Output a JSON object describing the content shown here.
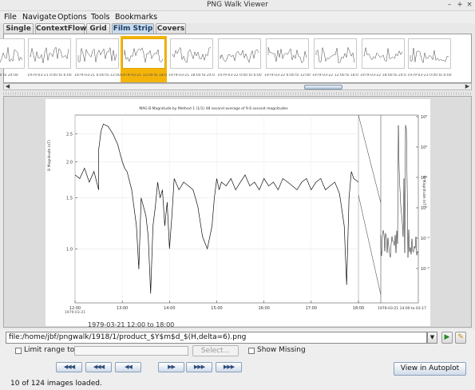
{
  "window": {
    "title": "PNG Walk Viewer",
    "controls": [
      "–",
      "+",
      "×"
    ]
  },
  "menu": [
    "File",
    "Navigate",
    "Options",
    "Tools",
    "Bookmarks"
  ],
  "tabs": [
    {
      "label": "Single"
    },
    {
      "label": "ContextFlow"
    },
    {
      "label": "Grid"
    },
    {
      "label": "Film Strip",
      "active": true
    },
    {
      "label": "Covers"
    }
  ],
  "filmstrip": {
    "thumbnails": [
      {
        "caption": "...18:00 to 24:00"
      },
      {
        "caption": "1979-03-21 0:00 to 6:00"
      },
      {
        "caption": "1979-03-21 6:00 to 12:00"
      },
      {
        "caption": "1979-03-21 12:00 to 18:00",
        "selected": true
      },
      {
        "caption": "1979-03-21 18:00 to 24:00"
      },
      {
        "caption": "1979-03-22 0:00 to 6:00"
      },
      {
        "caption": "1979-03-22 6:00 to 12:00"
      },
      {
        "caption": "1979-03-22 12:00 to 18:00"
      },
      {
        "caption": "1979-03-22 18:00 to 24:00"
      },
      {
        "caption": "1979-03-23 0:00 to 6:00"
      }
    ],
    "scroll_left": "◀",
    "scroll_right": "▶"
  },
  "image": {
    "chart_title": "MAG B Magnitude by Method 1 (1/1) 48 second average of 9.6 second magnitudes",
    "y_label": "B Magnitude (nT)",
    "y_label_right": "B Magnitude (nT)",
    "y_ticks": [
      "2.5",
      "2.0",
      "1.5",
      "1.0"
    ],
    "x_ticks": [
      "12:00",
      "13:00",
      "14:00",
      "15:00",
      "16:00",
      "17:00",
      "18:00"
    ],
    "x_tick0_sub": "1979-03-21",
    "right_ticks": [
      "10³",
      "10²",
      "10¹",
      "10⁰",
      "10⁻¹",
      "10⁻²"
    ],
    "right_x_label": "1979-03-21 14:00 to 03-17",
    "time_range": "1979-03-21 12:00 to 18:00"
  },
  "chart_data": {
    "type": "line",
    "title": "MAG B Magnitude by Method 1 (1/1) 48 second average of 9.6 second magnitudes",
    "xlabel": "",
    "ylabel": "B Magnitude (nT)",
    "xlim": [
      12,
      18
    ],
    "ylim": [
      0.65,
      2.9
    ],
    "y_scale": "log",
    "series": [
      {
        "x": [
          12.0,
          12.1,
          12.2,
          12.3,
          12.4,
          12.5,
          12.5,
          12.55,
          12.6,
          12.7,
          12.8,
          12.9,
          13.0,
          13.05,
          13.1,
          13.2,
          13.3,
          13.35,
          13.4,
          13.5,
          13.55,
          13.6,
          13.65,
          13.7,
          13.75,
          13.8,
          13.85,
          13.9,
          13.95,
          14.0,
          14.05,
          14.1,
          14.2,
          14.3,
          14.4,
          14.5,
          14.6,
          14.7,
          14.8,
          14.9,
          14.95,
          15.0,
          15.05,
          15.1,
          15.2,
          15.3,
          15.4,
          15.5,
          15.6,
          15.7,
          15.8,
          15.9,
          16.0,
          16.1,
          16.2,
          16.3,
          16.4,
          16.5,
          16.6,
          16.7,
          16.8,
          16.9,
          17.0,
          17.1,
          17.2,
          17.3,
          17.4,
          17.5,
          17.6,
          17.7,
          17.75,
          17.8,
          17.85,
          17.9,
          18.0
        ],
        "values": [
          1.8,
          1.75,
          1.9,
          1.7,
          1.85,
          1.6,
          2.2,
          2.55,
          2.7,
          2.65,
          2.5,
          2.3,
          2.0,
          1.9,
          1.85,
          1.6,
          1.2,
          0.85,
          1.5,
          1.3,
          1.1,
          0.7,
          1.2,
          1.4,
          1.7,
          1.5,
          1.6,
          1.2,
          1.45,
          1.0,
          1.3,
          1.75,
          1.6,
          1.7,
          1.65,
          1.6,
          1.4,
          1.1,
          1.0,
          1.2,
          1.5,
          1.75,
          1.6,
          1.7,
          1.65,
          1.75,
          1.6,
          1.7,
          1.8,
          1.65,
          1.7,
          1.6,
          1.75,
          1.65,
          1.7,
          1.6,
          1.75,
          1.7,
          1.65,
          1.6,
          1.7,
          1.75,
          1.6,
          1.7,
          1.75,
          1.6,
          1.65,
          1.7,
          1.55,
          1.2,
          0.75,
          1.5,
          1.85,
          1.75,
          1.7
        ]
      }
    ],
    "grid": true
  },
  "controls": {
    "url": "file:/home/jbf/pngwalk/1918/1/product_$Y$m$d_$(H,delta=6).png",
    "limit_range_label": "Limit range to:",
    "range_value": "",
    "select_label": "Select...",
    "show_missing_label": "Show Missing",
    "nav": [
      {
        "name": "first",
        "label": "◀◀◀"
      },
      {
        "name": "page-back",
        "label": "◀◀◀"
      },
      {
        "name": "prev",
        "label": "◀◀"
      },
      {
        "name": "next",
        "label": "▶▶"
      },
      {
        "name": "page-forward",
        "label": "▶▶▶"
      },
      {
        "name": "last",
        "label": "▶▶▶"
      }
    ],
    "autoplot_label": "View in Autoplot",
    "status": "10 of 124 images loaded."
  }
}
